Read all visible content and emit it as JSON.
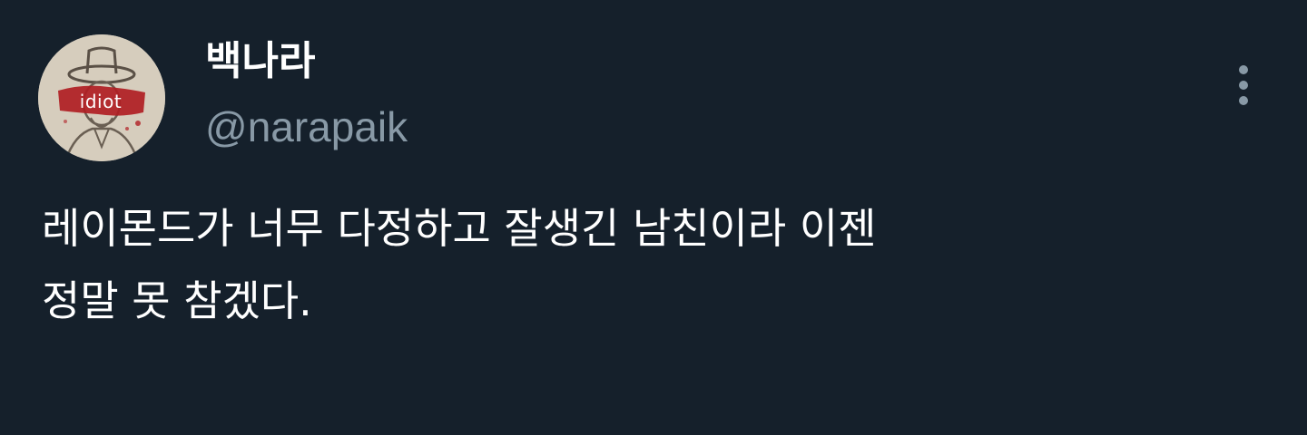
{
  "tweet": {
    "avatar": {
      "icon": "portrait-avatar-icon",
      "tag_text": "idiot",
      "tag_color": "#b01e23"
    },
    "display_name": "백나라",
    "handle": "@narapaik",
    "more_icon": "more-vertical-icon",
    "text_lines": [
      "레이몬드가 너무 다정하고 잘생긴 남친이라 이젠",
      "정말 못 참겠다."
    ]
  },
  "theme": {
    "background": "#15202b",
    "primary_text": "#ffffff",
    "secondary_text": "#8899a6"
  }
}
